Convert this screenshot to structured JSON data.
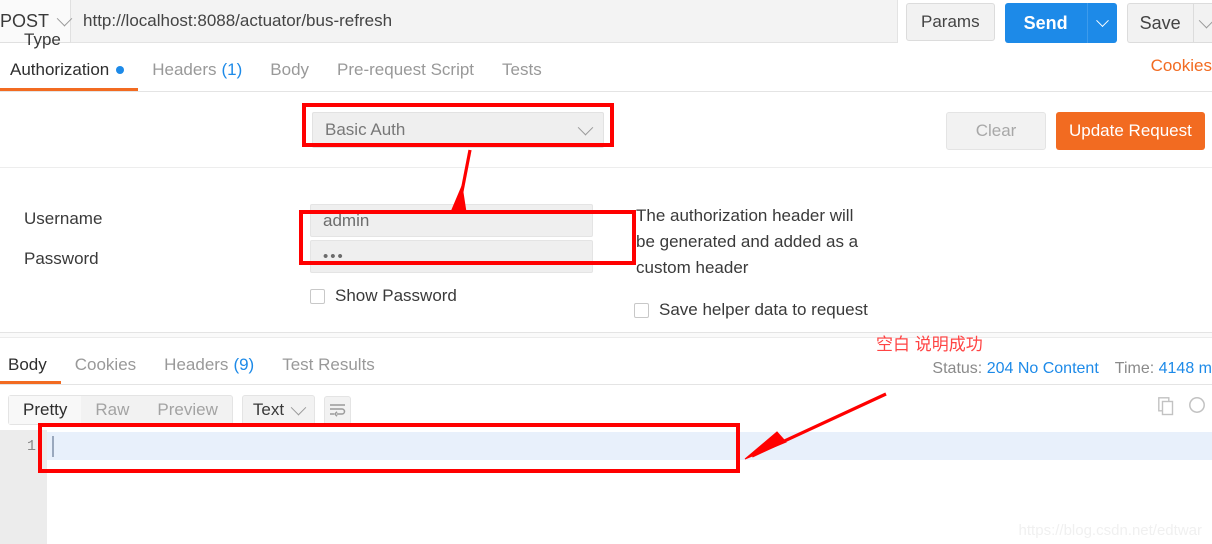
{
  "request_bar": {
    "method": "POST",
    "url": "http://localhost:8088/actuator/bus-refresh",
    "params_label": "Params",
    "send_label": "Send",
    "save_label": "Save"
  },
  "request_tabs": {
    "items": [
      {
        "label": "Authorization",
        "count": "",
        "active": true,
        "dot": true
      },
      {
        "label": "Headers",
        "count": "(1)",
        "active": false,
        "dot": false
      },
      {
        "label": "Body",
        "count": "",
        "active": false,
        "dot": false
      },
      {
        "label": "Pre-request Script",
        "count": "",
        "active": false,
        "dot": false
      },
      {
        "label": "Tests",
        "count": "",
        "active": false,
        "dot": false
      }
    ],
    "cookies_link": "Cookies"
  },
  "auth_panel": {
    "type_label": "Type",
    "type_value": "Basic Auth",
    "username_label": "Username",
    "username_value": "admin",
    "password_label": "Password",
    "password_value": "•••",
    "show_password_label": "Show Password",
    "save_helper_label": "Save helper data to request",
    "helper_text": "The authorization header will be generated and added as a custom header",
    "clear_label": "Clear",
    "update_label": "Update Request"
  },
  "response": {
    "tabs": [
      {
        "label": "Body",
        "count": "",
        "active": true
      },
      {
        "label": "Cookies",
        "count": "",
        "active": false
      },
      {
        "label": "Headers",
        "count": "(9)",
        "active": false
      },
      {
        "label": "Test Results",
        "count": "",
        "active": false
      }
    ],
    "status_label": "Status:",
    "status_value": "204 No Content",
    "time_label": "Time:",
    "time_value": "4148 m"
  },
  "body_toolbar": {
    "views": [
      {
        "label": "Pretty",
        "active": true
      },
      {
        "label": "Raw",
        "active": false
      },
      {
        "label": "Preview",
        "active": false
      }
    ],
    "format": "Text"
  },
  "editor": {
    "line_number": "1",
    "content": ""
  },
  "annotations": {
    "chinese_note": "空白 说明成功"
  },
  "watermark": "https://blog.csdn.net/edtwar",
  "colors": {
    "accent_orange": "#f26b21",
    "accent_blue": "#1d8ae8",
    "annotation_red": "#ff0000"
  }
}
